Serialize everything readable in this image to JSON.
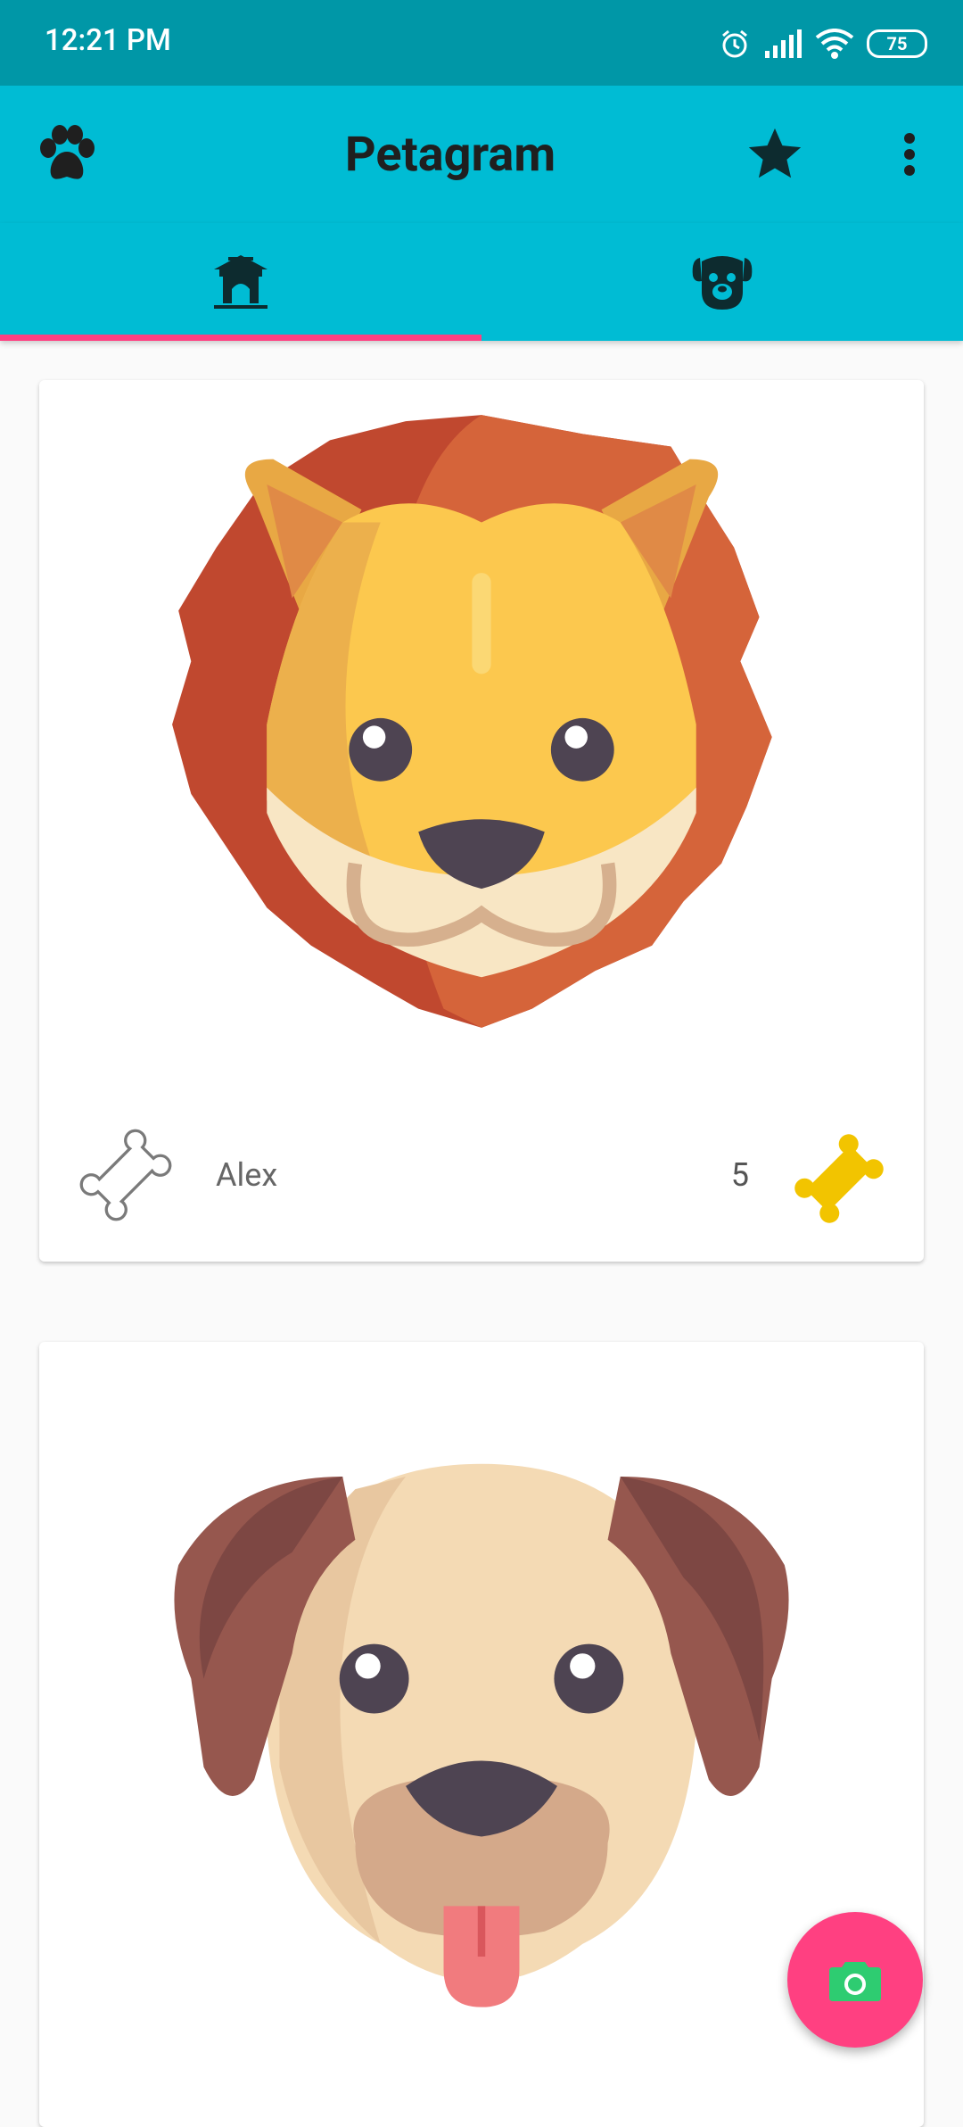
{
  "status_bar": {
    "time": "12:21 PM",
    "battery": "75"
  },
  "toolbar": {
    "title": "Petagram",
    "icons": {
      "left": "paw-icon",
      "favorites": "star-icon",
      "menu": "more-vert-icon"
    }
  },
  "tabs": [
    {
      "icon": "doghouse-icon",
      "selected": true
    },
    {
      "icon": "dog-face-icon",
      "selected": false
    }
  ],
  "pets": [
    {
      "name": "Alex",
      "likes": "5",
      "image": "lion-face"
    },
    {
      "name": "",
      "likes": "",
      "image": "dog-face"
    }
  ],
  "fab": {
    "icon": "camera-icon"
  },
  "colors": {
    "status_bar": "#0097a7",
    "toolbar": "#00bcd4",
    "accent": "#ff4081",
    "liked_bone": "#f2c400"
  }
}
